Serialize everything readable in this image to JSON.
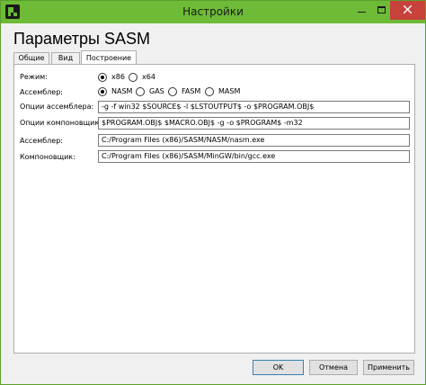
{
  "window": {
    "title": "Настройки"
  },
  "heading": "Параметры SASM",
  "tabs": [
    {
      "label": "Общие"
    },
    {
      "label": "Вид"
    },
    {
      "label": "Построение"
    }
  ],
  "build": {
    "mode": {
      "label": "Режим:",
      "options": [
        "x86",
        "x64"
      ],
      "selected": "x86"
    },
    "assembler_select": {
      "label": "Ассемблер:",
      "options": [
        "NASM",
        "GAS",
        "FASM",
        "MASM"
      ],
      "selected": "NASM"
    },
    "assembler_options": {
      "label": "Опции ассемблера:",
      "value": "-g -f win32 $SOURCE$ -l $LSTOUTPUT$ -o $PROGRAM.OBJ$"
    },
    "linker_options": {
      "label": "Опции компоновщика:",
      "value": "$PROGRAM.OBJ$ $MACRO.OBJ$ -g -o $PROGRAM$ -m32"
    },
    "assembler_path": {
      "label": "Ассемблер:",
      "value": "C:/Program Files (x86)/SASM/NASM/nasm.exe"
    },
    "linker_path": {
      "label": "Компоновщик:",
      "value": "C:/Program Files (x86)/SASM/MinGW/bin/gcc.exe"
    }
  },
  "buttons": {
    "ok": "OK",
    "cancel": "Отмена",
    "apply": "Применить"
  }
}
